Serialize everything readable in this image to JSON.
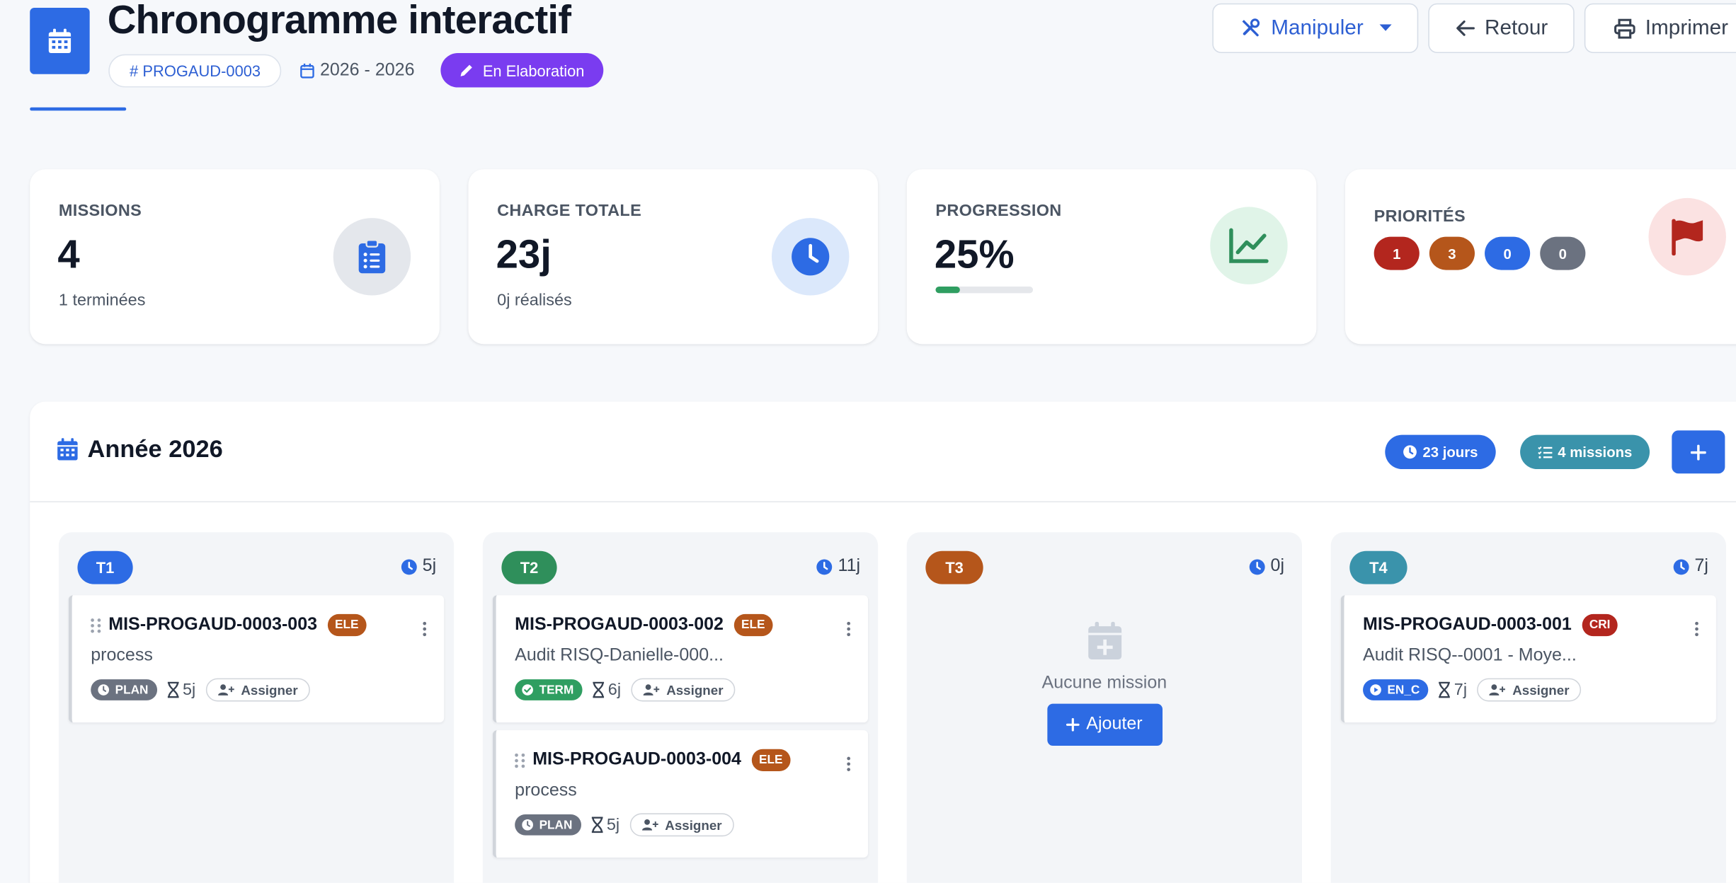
{
  "header": {
    "title": "Chronogramme interactif",
    "ref": "PROGAUD-0003",
    "date_range": "2026 - 2026",
    "status": "En Elaboration",
    "buttons": {
      "manipuler": "Manipuler",
      "retour": "Retour",
      "imprimer": "Imprimer"
    }
  },
  "stats": {
    "missions": {
      "label": "MISSIONS",
      "value": "4",
      "sub": "1 terminées"
    },
    "charge": {
      "label": "CHARGE TOTALE",
      "value": "23j",
      "sub": "0j réalisés"
    },
    "progression": {
      "label": "PROGRESSION",
      "value": "25%",
      "fraction": 0.25
    },
    "priorites": {
      "label": "PRIORITÉS",
      "pills": [
        {
          "value": "1",
          "color": "#b3261e"
        },
        {
          "value": "3",
          "color": "#b5561b"
        },
        {
          "value": "0",
          "color": "#2d6be4"
        },
        {
          "value": "0",
          "color": "#6b7280"
        }
      ]
    }
  },
  "year": {
    "title": "Année 2026",
    "days_badge": "23 jours",
    "missions_badge": "4 missions"
  },
  "quarters": [
    {
      "label": "T1",
      "color": "#2d6be4",
      "load": "5j",
      "missions": [
        {
          "code": "MIS-PROGAUD-0003-003",
          "priority": "ELE",
          "priority_color": "#b5561b",
          "desc": "process",
          "status": "PLAN",
          "status_color": "#6b7280",
          "duration": "5j",
          "assign": "Assigner"
        }
      ]
    },
    {
      "label": "T2",
      "color": "#2f8f5b",
      "load": "11j",
      "missions": [
        {
          "code": "MIS-PROGAUD-0003-002",
          "priority": "ELE",
          "priority_color": "#b5561b",
          "desc": "Audit RISQ-Danielle-000...",
          "status": "TERM",
          "status_color": "#2f9e61",
          "duration": "6j",
          "assign": "Assigner"
        },
        {
          "code": "MIS-PROGAUD-0003-004",
          "priority": "ELE",
          "priority_color": "#b5561b",
          "desc": "process",
          "status": "PLAN",
          "status_color": "#6b7280",
          "duration": "5j",
          "assign": "Assigner"
        }
      ]
    },
    {
      "label": "T3",
      "color": "#b5561b",
      "load": "0j",
      "missions": [],
      "empty_text": "Aucune mission",
      "empty_button": "Ajouter"
    },
    {
      "label": "T4",
      "color": "#3a93ab",
      "load": "7j",
      "missions": [
        {
          "code": "MIS-PROGAUD-0003-001",
          "priority": "CRI",
          "priority_color": "#b3261e",
          "desc": "Audit RISQ--0001 - Moye...",
          "status": "EN_C",
          "status_color": "#2d6be4",
          "duration": "7j",
          "assign": "Assigner"
        }
      ]
    }
  ]
}
